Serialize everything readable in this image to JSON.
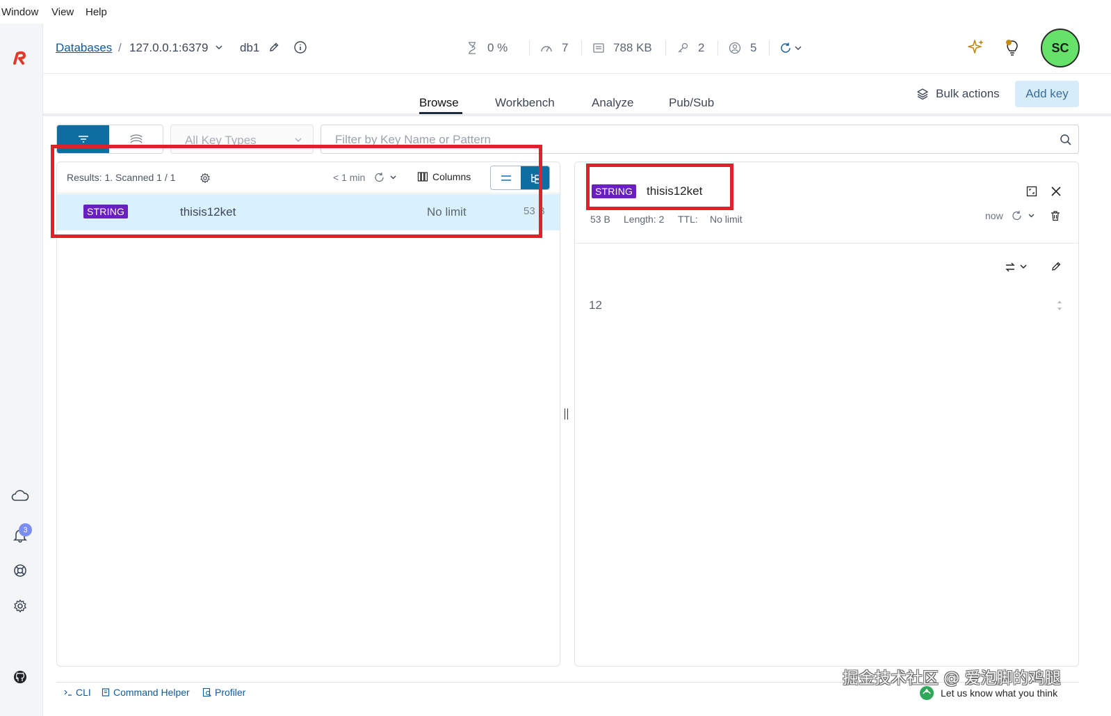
{
  "menubar": {
    "items": [
      "Window",
      "View",
      "Help"
    ]
  },
  "header": {
    "breadcrumb_databases": "Databases",
    "breadcrumb_sep": "/",
    "host": "127.0.0.1:6379",
    "db_name": "db1",
    "stats": {
      "cpu": "0 %",
      "ops": "7",
      "memory": "788 KB",
      "keys": "2",
      "clients": "5"
    },
    "avatar_initials": "SC",
    "avatar_color": "#66e26a"
  },
  "tabs": [
    "Browse",
    "Workbench",
    "Analyze",
    "Pub/Sub"
  ],
  "actions": {
    "bulk": "Bulk actions",
    "add_key": "Add key"
  },
  "filter": {
    "key_type_placeholder": "All Key Types",
    "search_placeholder": "Filter by Key Name or Pattern"
  },
  "list": {
    "results": "Results: 1. Scanned 1 / 1",
    "refreshed": "< 1 min",
    "columns_label": "Columns",
    "rows": [
      {
        "type": "STRING",
        "name": "thisis12ket",
        "ttl": "No limit",
        "size": "53 B"
      }
    ]
  },
  "details": {
    "type": "STRING",
    "key": "thisis12ket",
    "size": "53 B",
    "length": "Length: 2",
    "ttl_label": "TTL:",
    "ttl_value": "No limit",
    "refreshed": "now",
    "value": "12"
  },
  "sidebar": {
    "notification_count": "3"
  },
  "bottom": {
    "cli": "CLI",
    "command_helper": "Command Helper",
    "profiler": "Profiler",
    "feedback": "Let us know what you think"
  },
  "watermark": "掘金技术社区 @ 爱泡脚的鸡腿",
  "colors": {
    "accent": "#0f6ea1",
    "string_badge": "#6a1fbf",
    "selected_row": "#d9f1fc",
    "highlight": "#e0202d"
  }
}
